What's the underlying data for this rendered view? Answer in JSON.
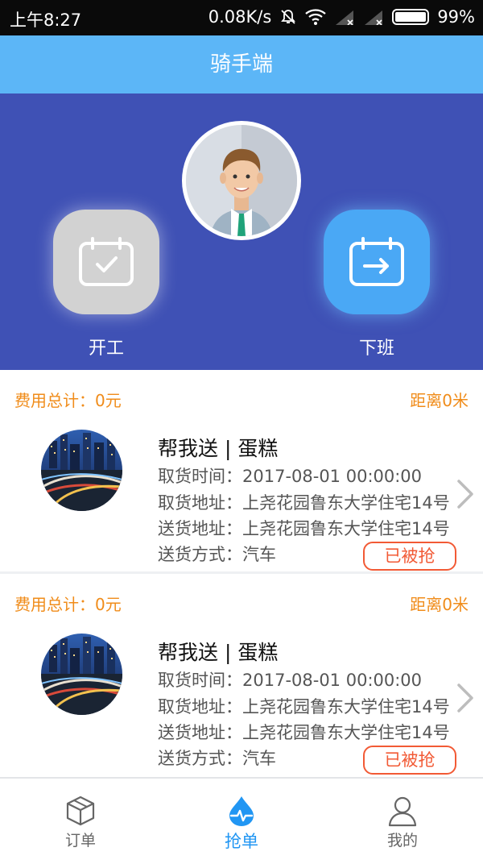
{
  "status_bar": {
    "time": "上午8:27",
    "net_speed": "0.08K/s",
    "battery": "99%"
  },
  "header": {
    "title": "骑手端"
  },
  "hero": {
    "start_label": "开工",
    "off_label": "下班"
  },
  "orders": [
    {
      "fee": "费用总计：0元",
      "distance": "距离0米",
      "title": "帮我送 | 蛋糕",
      "pickup_time": "取货时间：2017-08-01 00:00:00",
      "pickup_address": "取货地址：上尧花园鲁东大学住宅14号",
      "delivery_address": "送货地址：上尧花园鲁东大学住宅14号",
      "delivery_method": "送货方式：汽车",
      "status": "已被抢"
    },
    {
      "fee": "费用总计：0元",
      "distance": "距离0米",
      "title": "帮我送 | 蛋糕",
      "pickup_time": "取货时间：2017-08-01 00:00:00",
      "pickup_address": "取货地址：上尧花园鲁东大学住宅14号",
      "delivery_address": "送货地址：上尧花园鲁东大学住宅14号",
      "delivery_method": "送货方式：汽车",
      "status": "已被抢"
    }
  ],
  "bottom_nav": {
    "orders": "订单",
    "grab": "抢单",
    "mine": "我的"
  },
  "colors": {
    "title_bar": "#5cb6f7",
    "hero_bg": "#3f51b5",
    "accent_orange": "#f08c1a",
    "status_red": "#f25a35",
    "active_blue": "#2196f3"
  },
  "icons": {
    "start": "calendar-check-icon",
    "off": "calendar-arrow-icon",
    "orders_tab": "box-icon",
    "grab_tab": "drop-pulse-icon",
    "mine_tab": "person-icon"
  }
}
